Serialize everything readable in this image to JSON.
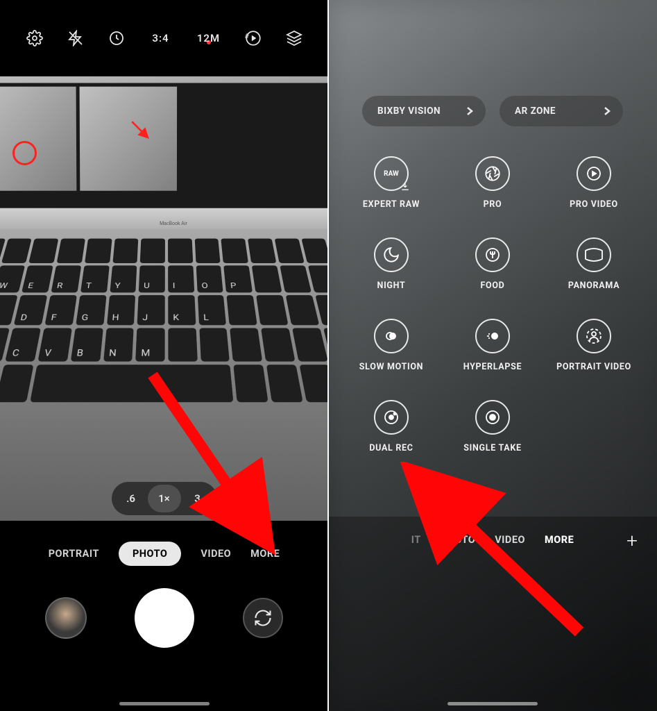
{
  "left": {
    "toolbar": {
      "ratio": "3:4",
      "resolution": "12M"
    },
    "laptop": {
      "brand": "MacBook Air"
    },
    "zoom": {
      "z1": ".6",
      "z2": "1×",
      "z3": "3"
    },
    "modes": {
      "portrait": "PORTRAIT",
      "photo": "PHOTO",
      "video": "VIDEO",
      "more": "MORE"
    }
  },
  "right": {
    "chips": {
      "bixby": "BIXBY VISION",
      "arzone": "AR ZONE"
    },
    "grid": {
      "expert_raw": "EXPERT RAW",
      "pro": "PRO",
      "pro_video": "PRO VIDEO",
      "night": "NIGHT",
      "food": "FOOD",
      "panorama": "PANORAMA",
      "slow_motion": "SLOW MOTION",
      "hyperlapse": "HYPERLAPSE",
      "portrait_video": "PORTRAIT VIDEO",
      "dual_rec": "DUAL REC",
      "single_take": "SINGLE TAKE"
    },
    "modes": {
      "it": "IT",
      "photo": "PHOTO",
      "video": "VIDEO",
      "more": "MORE"
    },
    "raw_label": "RAW"
  },
  "colors": {
    "accent_red": "#ff0505"
  }
}
